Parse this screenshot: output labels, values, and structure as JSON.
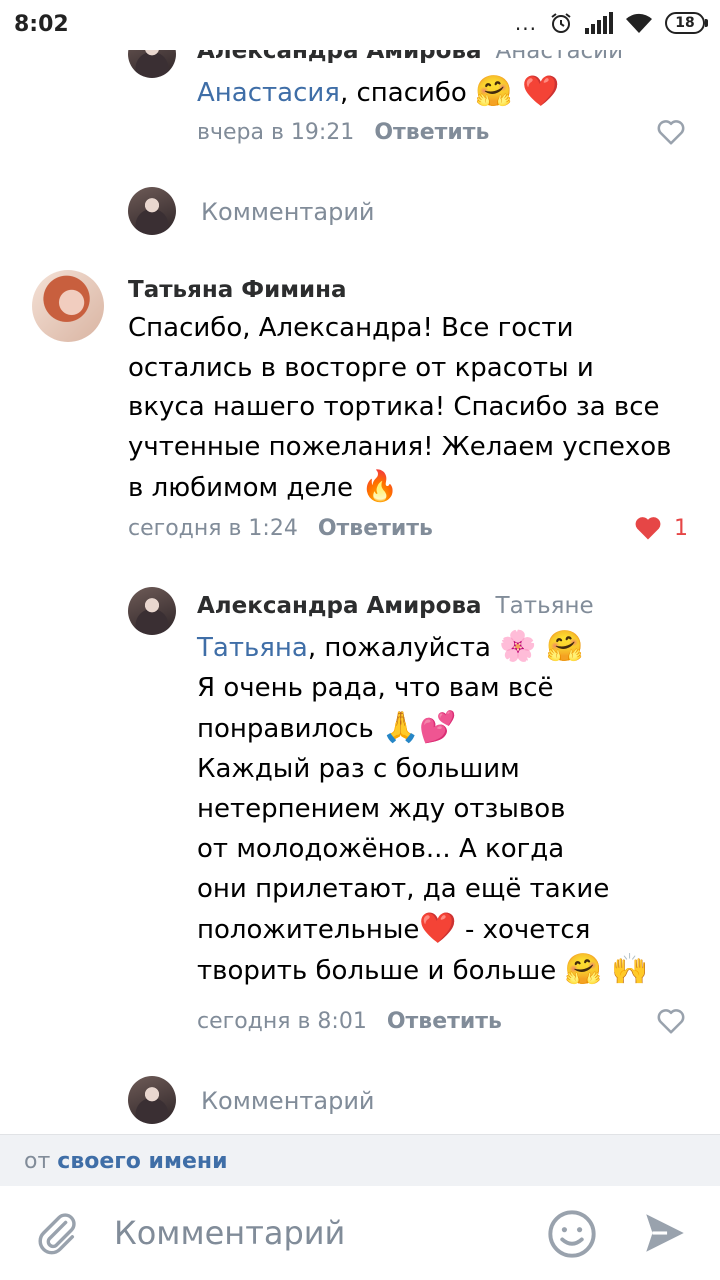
{
  "status_bar": {
    "time": "8:02",
    "battery": "18",
    "dots": "..."
  },
  "comments": {
    "top_reply": {
      "author": "Александра Амирова",
      "reply_to": "Анастасии",
      "mention": "Анастасия",
      "text": ", спасибо",
      "emoji": "🤗 ❤️",
      "time": "вчера в 19:21",
      "reply_label": "Ответить"
    },
    "comment_box_1": {
      "placeholder": "Комментарий"
    },
    "main_comment": {
      "author": "Татьяна Фимина",
      "text_lines": [
        "Спасибо, Александра! Все гости",
        "остались в восторге от красоты и",
        "вкуса нашего тортика! Спасибо за все",
        "учтенные пожелания! Желаем успехов",
        "в любимом деле"
      ],
      "emoji_end": "🔥",
      "time": "сегодня в 1:24",
      "reply_label": "Ответить",
      "likes": "1"
    },
    "reply": {
      "author": "Александра Амирова",
      "reply_to": "Татьяне",
      "mention": "Татьяна",
      "line1_text": ",  пожалуйста",
      "line1_emoji": "🌸 🤗",
      "line2": "Я очень рада, что вам всё",
      "line3": "понравилось",
      "line3_emoji": "🙏💕",
      "line4": "Каждый раз с большим",
      "line5": "нетерпением жду отзывов",
      "line6": "от молодожёнов... А когда",
      "line7": "они прилетают, да ещё такие",
      "line8_a": "положительные",
      "line8_emoji": "❤️",
      "line8_b": " - хочется",
      "line9": "творить больше и больше",
      "line9_emoji": "🤗 🙌",
      "time": "сегодня в 8:01",
      "reply_label": "Ответить"
    },
    "comment_box_2": {
      "placeholder": "Комментарий"
    }
  },
  "footer": {
    "from_prefix": "от ",
    "from_link": "своего имени",
    "input_placeholder": "Комментарий"
  },
  "colors": {
    "link": "#3f6ea7",
    "meta": "#818c99",
    "like_red": "#e64646"
  }
}
